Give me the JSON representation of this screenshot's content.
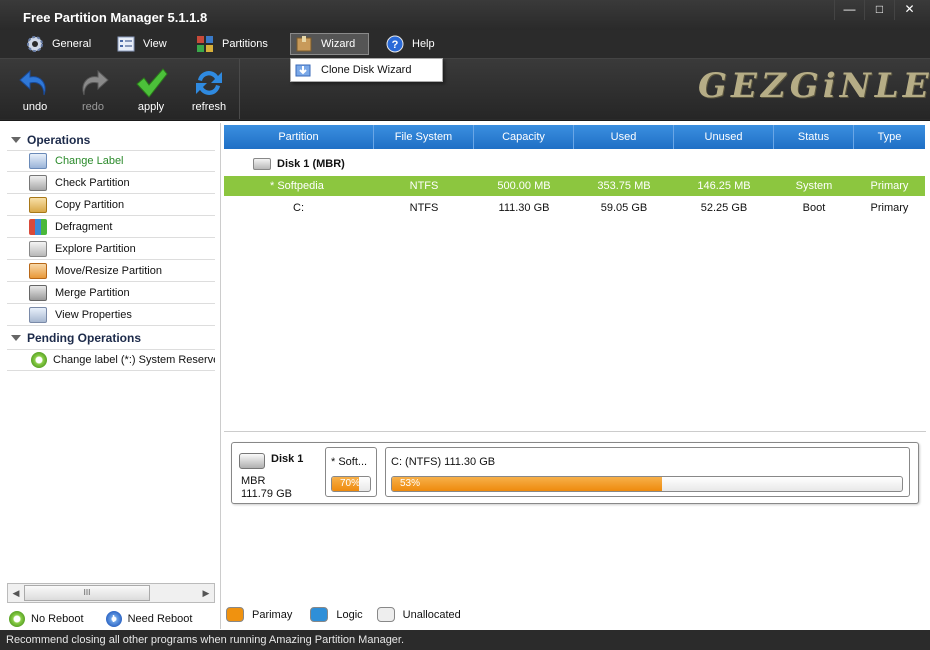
{
  "window": {
    "title": "Free Partition Manager 5.1.1.8",
    "controls": [
      "—",
      "□",
      "✕"
    ]
  },
  "menu": {
    "items": [
      {
        "label": "General",
        "icon": "gear-icon"
      },
      {
        "label": "View",
        "icon": "view-icon"
      },
      {
        "label": "Partitions",
        "icon": "partitions-icon"
      },
      {
        "label": "Wizard",
        "icon": "wizard-icon"
      },
      {
        "label": "Help",
        "icon": "help-icon"
      }
    ],
    "dropdown": {
      "item": "Clone Disk Wizard",
      "icon": "clone-disk-icon"
    }
  },
  "toolbar": {
    "undo": "undo",
    "redo": "redo",
    "apply": "apply",
    "refresh": "refresh",
    "logo": "GEZGiNLER"
  },
  "left": {
    "operations_title": "Operations",
    "operations": [
      {
        "label": "Change Label",
        "icon": "change-label-icon"
      },
      {
        "label": "Check Partition",
        "icon": "check-partition-icon"
      },
      {
        "label": "Copy Partition",
        "icon": "copy-partition-icon"
      },
      {
        "label": "Defragment",
        "icon": "defragment-icon"
      },
      {
        "label": "Explore Partition",
        "icon": "explore-partition-icon"
      },
      {
        "label": "Move/Resize Partition",
        "icon": "move-resize-icon"
      },
      {
        "label": "Merge Partition",
        "icon": "merge-partition-icon"
      },
      {
        "label": "View Properties",
        "icon": "view-properties-icon"
      }
    ],
    "pending_title": "Pending Operations",
    "pending": [
      "Change label (*:) System Reserved"
    ],
    "scroll_grip": "III",
    "legend": {
      "no_reboot": "No Reboot",
      "need_reboot": "Need Reboot"
    }
  },
  "table": {
    "columns": [
      "Partition",
      "File System",
      "Capacity",
      "Used",
      "Unused",
      "Status",
      "Type"
    ],
    "disk_label": "Disk 1 (MBR)",
    "rows": [
      {
        "partition": "*  Softpedia",
        "fs": "NTFS",
        "capacity": "500.00 MB",
        "used": "353.75 MB",
        "unused": "146.25 MB",
        "status": "System",
        "type": "Primary"
      },
      {
        "partition": "C:",
        "fs": "NTFS",
        "capacity": "111.30 GB",
        "used": "59.05 GB",
        "unused": "52.25 GB",
        "status": "Boot",
        "type": "Primary"
      }
    ]
  },
  "diskmap": {
    "disk_name": "Disk 1",
    "scheme": "MBR",
    "size": "111.79 GB",
    "partitions": [
      {
        "label": "* Soft...",
        "percent_label": "70%",
        "used_fraction": 0.7
      },
      {
        "label": "C: (NTFS) 111.30 GB",
        "percent_label": "53%",
        "used_fraction": 0.53
      }
    ]
  },
  "legend": {
    "primary": "Parimay",
    "logic": "Logic",
    "unallocated": "Unallocated",
    "colors": {
      "primary": "#f0920f",
      "logic": "#2f8fd8",
      "unallocated": "#eeeeee"
    }
  },
  "status": "Recommend closing all other programs when running Amazing Partition Manager."
}
